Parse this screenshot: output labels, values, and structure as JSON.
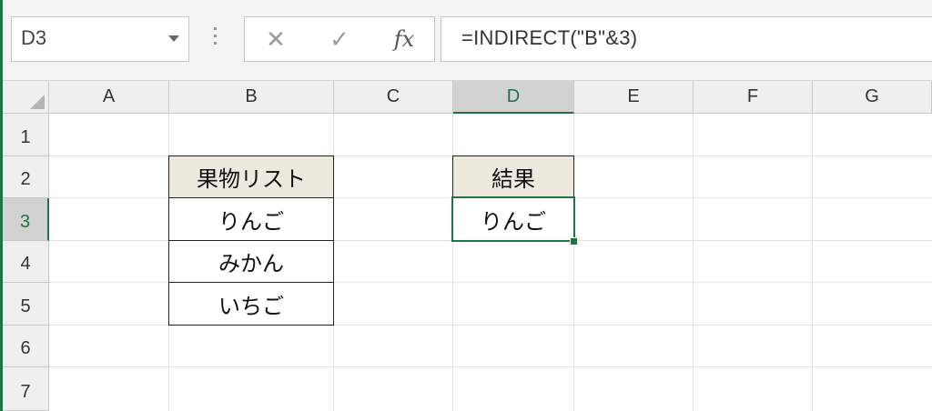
{
  "formula_bar": {
    "name_box": "D3",
    "cancel_symbol": "✕",
    "enter_symbol": "✓",
    "fx_symbol": "fx",
    "formula": "=INDIRECT(\"B\"&3)"
  },
  "columns": [
    "A",
    "B",
    "C",
    "D",
    "E",
    "F",
    "G"
  ],
  "rows": [
    "1",
    "2",
    "3",
    "4",
    "5",
    "6",
    "7"
  ],
  "selected_cell": "D3",
  "cells": {
    "B2": "果物リスト",
    "B3": "りんご",
    "B4": "みかん",
    "B5": "いちご",
    "D2": "結果",
    "D3": "りんご"
  },
  "colors": {
    "accent": "#217346",
    "header_fill": "#ede9df"
  }
}
